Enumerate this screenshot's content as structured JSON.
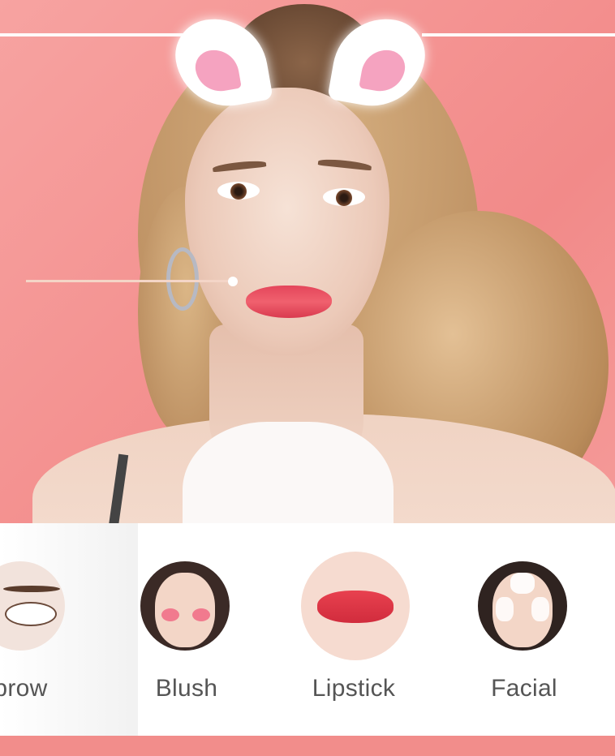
{
  "canvas": {
    "background": "#f59a98"
  },
  "preview": {
    "filter": "cat-ears",
    "slider": {
      "value": 0.52
    }
  },
  "panel": {
    "items": [
      {
        "label": "ebrow",
        "icon": "eyebrow-thumbnail"
      },
      {
        "label": "Blush",
        "icon": "blush-thumbnail"
      },
      {
        "label": "Lipstick",
        "icon": "lipstick-thumbnail",
        "selected": true
      },
      {
        "label": "Facial",
        "icon": "facial-thumbnail"
      }
    ]
  },
  "colors": {
    "accent": "#f28d8b",
    "label_text": "#555555",
    "panel_bg": "#ffffff"
  }
}
